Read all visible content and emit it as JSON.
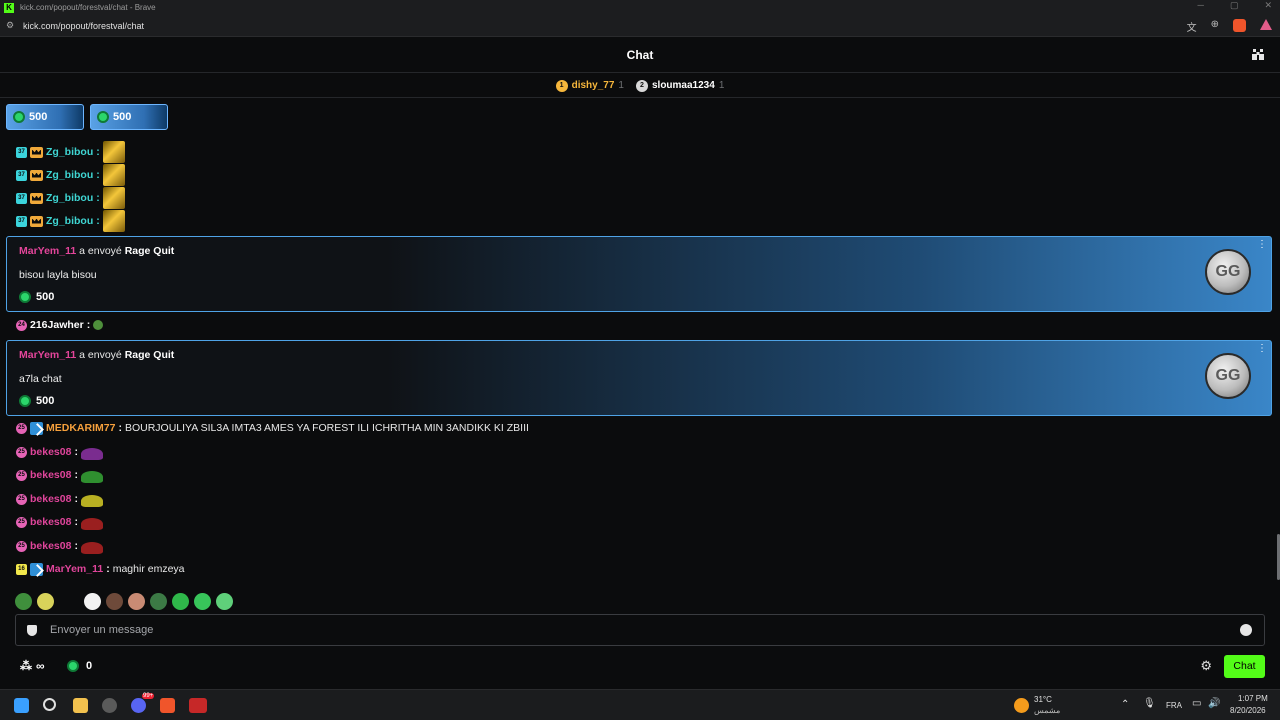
{
  "browser": {
    "window_title": "kick.com/popout/forestval/chat - Brave",
    "url": "kick.com/popout/forestval/chat"
  },
  "header": {
    "title": "Chat"
  },
  "leaderboard": [
    {
      "rank": "1",
      "name": "dishy_77",
      "count": "1",
      "color": "#f6b73c"
    },
    {
      "rank": "2",
      "name": "sloumaa1234",
      "count": "1",
      "color": "#d8d8d8"
    }
  ],
  "pinned_kicks": [
    {
      "amount": "500"
    },
    {
      "amount": "500"
    }
  ],
  "messages": [
    {
      "badge": "37",
      "user": "Zg_bibou",
      "sep": ":"
    },
    {
      "badge": "37",
      "user": "Zg_bibou",
      "sep": ":"
    },
    {
      "badge": "37",
      "user": "Zg_bibou",
      "sep": ":"
    },
    {
      "badge": "37",
      "user": "Zg_bibou",
      "sep": ":"
    }
  ],
  "gifts": [
    {
      "sender": "MarYem_11",
      "verb": "a envoyé",
      "gift": "Rage Quit",
      "message": "bisou layla bisou",
      "amount": "500",
      "icon_text": "GG"
    },
    {
      "sender": "MarYem_11",
      "verb": "a envoyé",
      "gift": "Rage Quit",
      "message": "a7la chat",
      "amount": "500",
      "icon_text": "GG"
    }
  ],
  "msg_216": {
    "badge": "24",
    "user": "216Jawher",
    "sep": ":"
  },
  "msg_medkarim": {
    "badge": "25",
    "user": "MEDKARIM77",
    "sep": ":",
    "text": "BOURJOULIYA SIL3A IMTA3 AMES YA FOREST ILI ICHRITHA MIN 3ANDIKK KI ZBIII"
  },
  "bekes_messages": [
    {
      "badge": "25",
      "user": "bekes08",
      "sep": ":",
      "emote_color": "#7a2c8f"
    },
    {
      "badge": "25",
      "user": "bekes08",
      "sep": ":",
      "emote_color": "#2f8f2f"
    },
    {
      "badge": "25",
      "user": "bekes08",
      "sep": ":",
      "emote_color": "#b8b022"
    },
    {
      "badge": "25",
      "user": "bekes08",
      "sep": ":",
      "emote_color": "#9a1f1f"
    },
    {
      "badge": "25",
      "user": "bekes08",
      "sep": ":",
      "emote_color": "#9a1f1f"
    }
  ],
  "msg_maryem": {
    "badge": "16",
    "user": "MarYem_11",
    "sep": ":",
    "text": "maghir emzeya"
  },
  "input": {
    "placeholder": "Envoyer un message"
  },
  "toolbar": {
    "infinity": "∞",
    "kicks_balance": "0",
    "chat_button": "Chat"
  },
  "taskbar": {
    "weather_temp": "31°C",
    "weather_label": "مشمس",
    "language": "FRA",
    "time": "1:07 PM",
    "date": "8/20/2026",
    "discord_badge": "99+"
  }
}
